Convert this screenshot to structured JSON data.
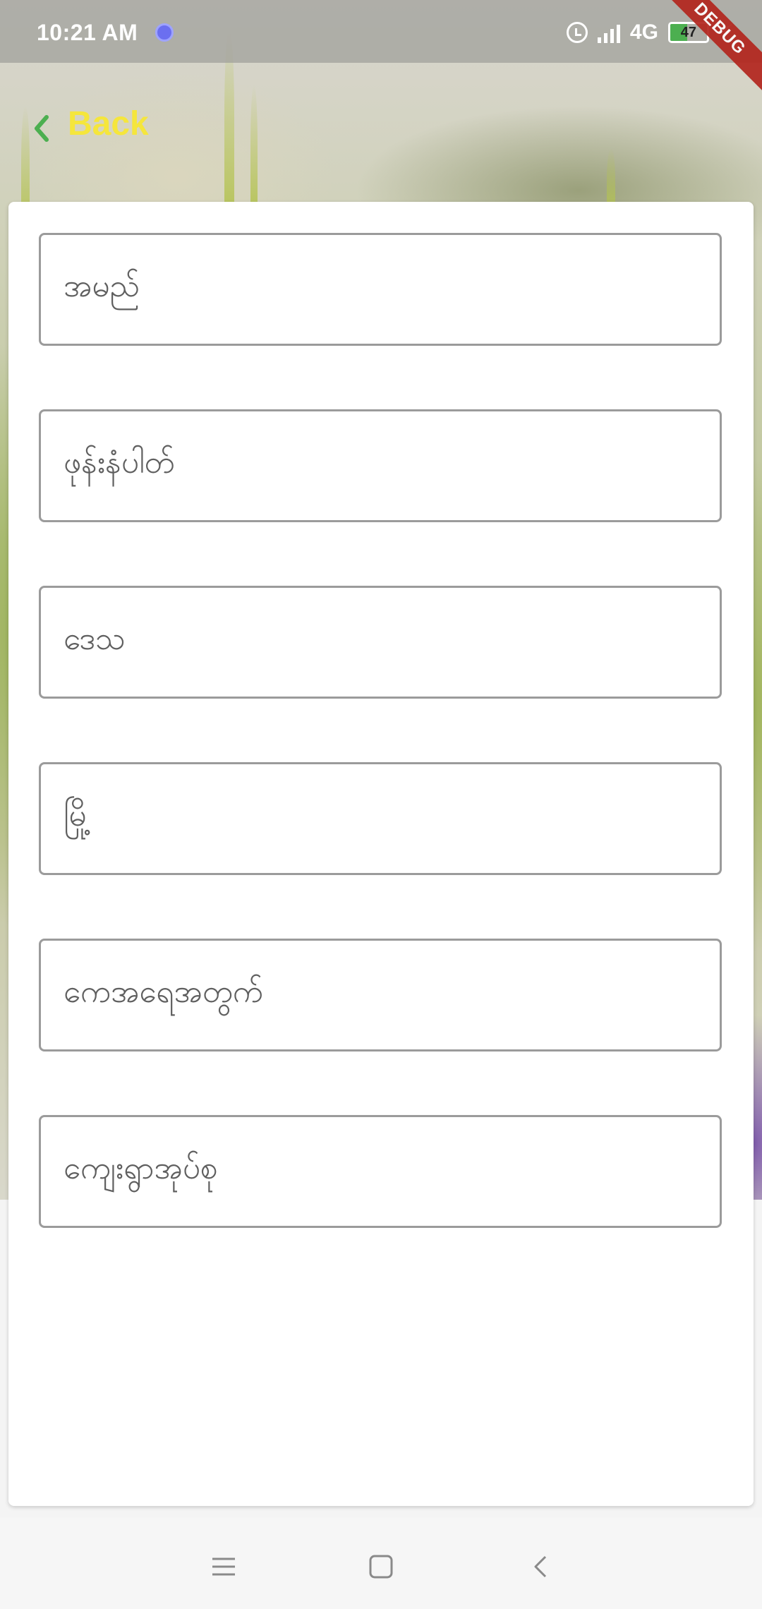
{
  "status_bar": {
    "time": "10:21 AM",
    "network": "4G",
    "battery_level": "47",
    "battery_fraction": 0.47
  },
  "debug_banner": "DEBUG",
  "header": {
    "back_label": "Back",
    "back_icon": "chevron-left-icon",
    "back_icon_color": "#4caf50",
    "back_label_color": "#f5e63c"
  },
  "form": {
    "fields": [
      {
        "name": "name-field",
        "label": "အမည်"
      },
      {
        "name": "phone-field",
        "label": "ဖုန်းနံပါတ်"
      },
      {
        "name": "region-field",
        "label": "ဒေသ"
      },
      {
        "name": "city-field",
        "label": "မြို့"
      },
      {
        "name": "village-tract-field",
        "label": "ကေအရေအတွက်"
      },
      {
        "name": "village-group-field",
        "label": "ကျေးရွာအုပ်စု"
      }
    ]
  },
  "nav_bar": {
    "menu_icon": "menu-icon",
    "home_icon": "home-square-icon",
    "back_icon": "back-arrow-icon"
  }
}
